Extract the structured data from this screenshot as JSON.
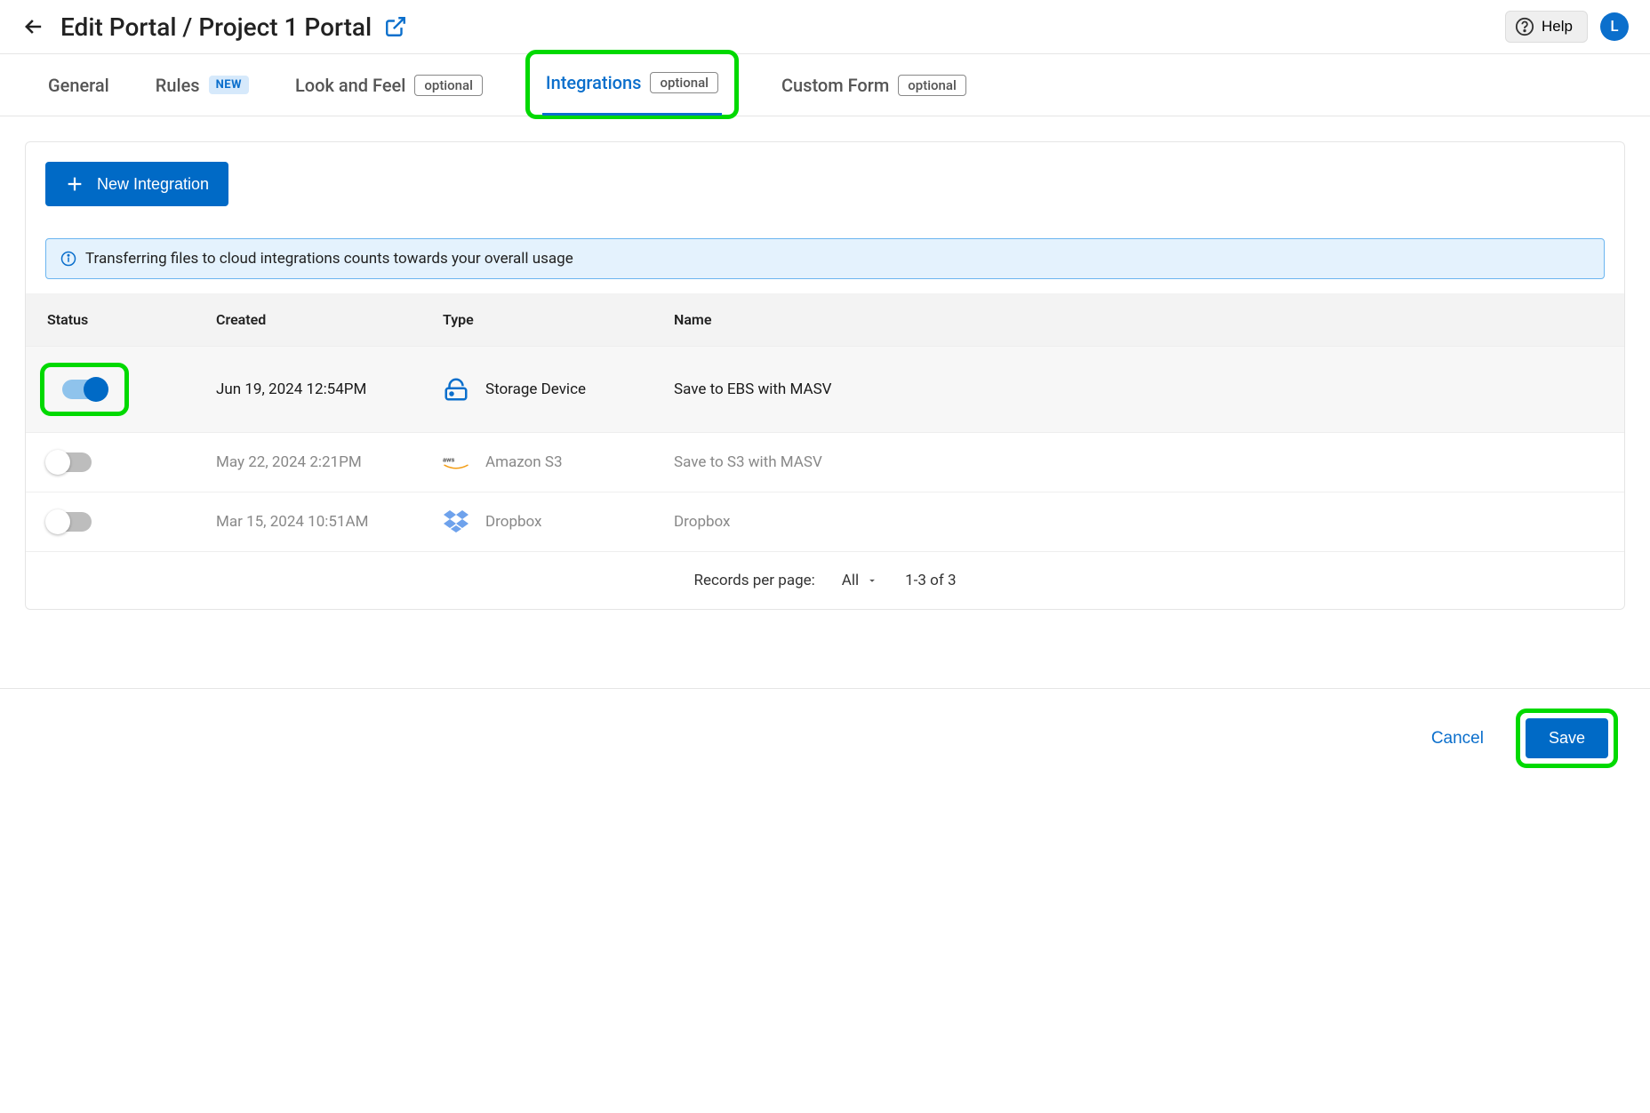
{
  "header": {
    "title": "Edit Portal / Project 1 Portal",
    "help_label": "Help",
    "avatar_letter": "L"
  },
  "tabs": {
    "general": "General",
    "rules": "Rules",
    "new_badge": "NEW",
    "look_and_feel": "Look and Feel",
    "integrations": "Integrations",
    "custom_form": "Custom Form",
    "optional_badge": "optional"
  },
  "panel": {
    "new_button": "New Integration",
    "info_banner": "Transferring files to cloud integrations counts towards your overall usage",
    "columns": {
      "status": "Status",
      "created": "Created",
      "type": "Type",
      "name": "Name"
    },
    "rows": [
      {
        "enabled": true,
        "created": "Jun 19, 2024 12:54PM",
        "icon": "storage",
        "type": "Storage Device",
        "name": "Save to EBS with MASV"
      },
      {
        "enabled": false,
        "created": "May 22, 2024 2:21PM",
        "icon": "aws",
        "type": "Amazon S3",
        "name": "Save to S3 with MASV"
      },
      {
        "enabled": false,
        "created": "Mar 15, 2024 10:51AM",
        "icon": "dropbox",
        "type": "Dropbox",
        "name": "Dropbox"
      }
    ],
    "pagination": {
      "records_label": "Records per page:",
      "records_value": "All",
      "range": "1-3 of 3"
    }
  },
  "footer": {
    "cancel": "Cancel",
    "save": "Save"
  }
}
